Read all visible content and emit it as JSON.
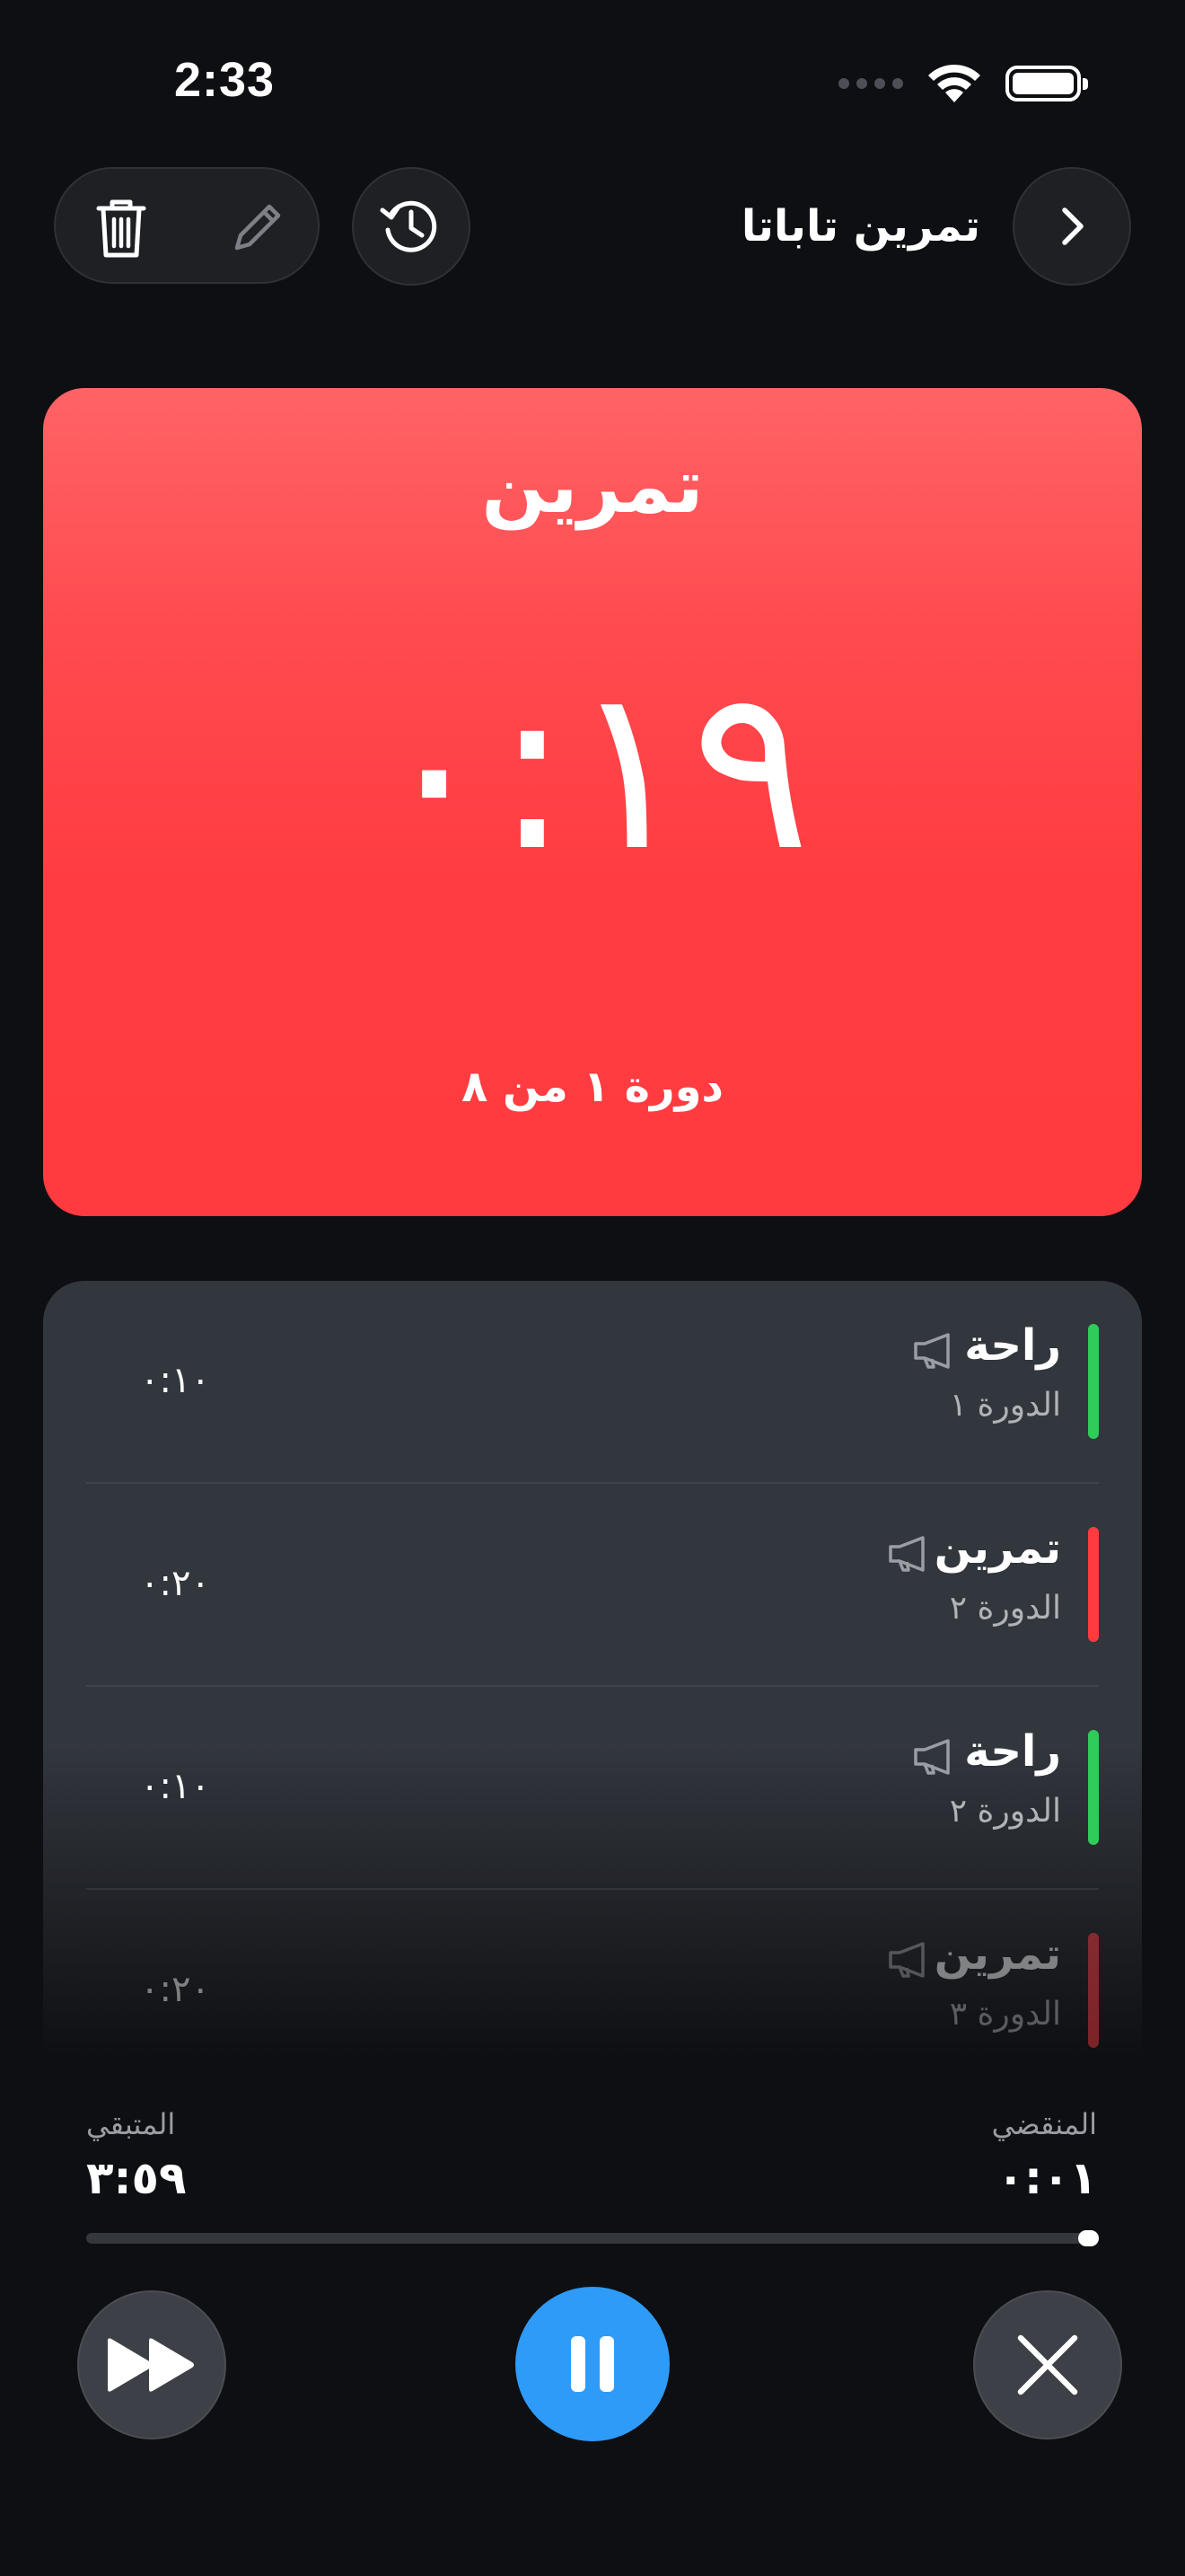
{
  "status_bar": {
    "time": "2:33"
  },
  "header": {
    "workout_title": "تمرين تاباتا"
  },
  "current_phase": {
    "name": "تمرين",
    "time": "٠:١٩",
    "round_text": "دورة ١ من ٨",
    "color": "#ff3b40"
  },
  "intervals": [
    {
      "name": "راحة",
      "round": "الدورة ١",
      "time": "٠:١٠",
      "color": "#2fcc59"
    },
    {
      "name": "تمرين",
      "round": "الدورة ٢",
      "time": "٠:٢٠",
      "color": "#ff3b40"
    },
    {
      "name": "راحة",
      "round": "الدورة ٢",
      "time": "٠:١٠",
      "color": "#2fcc59"
    },
    {
      "name": "تمرين",
      "round": "الدورة ٣",
      "time": "٠:٢٠",
      "color": "#ff3b40"
    }
  ],
  "stats": {
    "elapsed_label": "المنقضي",
    "elapsed_value": "٠:٠١",
    "remaining_label": "المتبقي",
    "remaining_value": "٣:٥٩"
  },
  "progress": {
    "fraction": 0.02
  },
  "colors": {
    "accent": "#2f9bf8",
    "work": "#ff3b40",
    "rest": "#2fcc59"
  },
  "icons": [
    "trash-icon",
    "pencil-icon",
    "history-icon",
    "chevron-right-icon",
    "megaphone-icon",
    "skip-forward-icon",
    "pause-icon",
    "close-icon"
  ]
}
